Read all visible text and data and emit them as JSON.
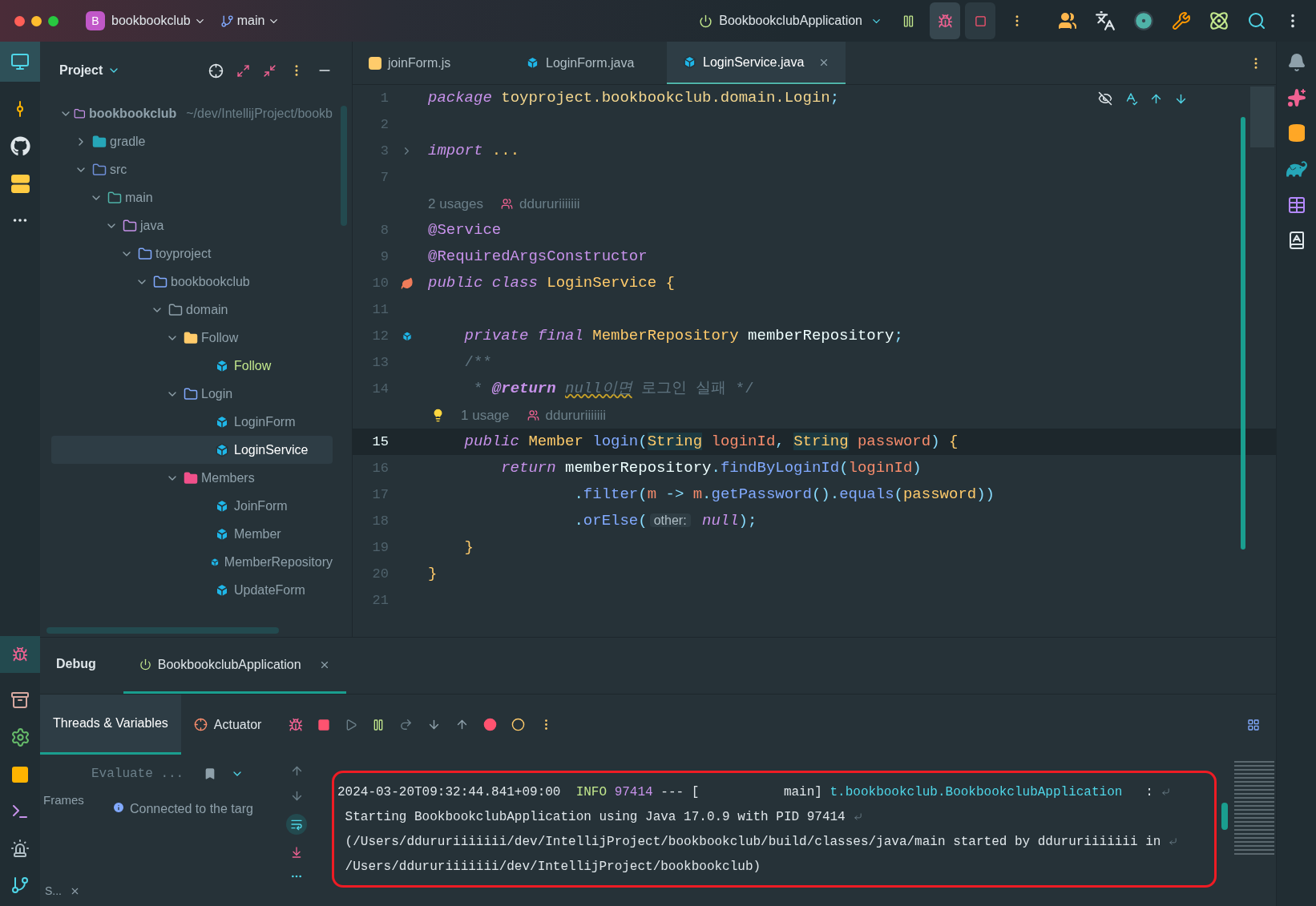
{
  "title_bar": {
    "project_badge": "B",
    "project": "bookbookclub",
    "branch": "main",
    "run_config": "BookbookclubApplication"
  },
  "project_panel": {
    "title": "Project",
    "tree": [
      {
        "label": "bookbookclub",
        "path": "~/dev/IntellijProject/bookb",
        "kind": "module",
        "expanded": true,
        "selected": false,
        "children": [
          {
            "label": "gradle",
            "kind": "gradle",
            "expanded": false,
            "selected": false
          },
          {
            "label": "src",
            "kind": "src",
            "expanded": true,
            "selected": false,
            "children": [
              {
                "label": "main",
                "kind": "main",
                "expanded": true,
                "selected": false,
                "children": [
                  {
                    "label": "java",
                    "kind": "java",
                    "expanded": true,
                    "selected": false,
                    "children": [
                      {
                        "label": "toyproject",
                        "kind": "folder",
                        "expanded": true,
                        "selected": false,
                        "children": [
                          {
                            "label": "bookbookclub",
                            "kind": "folder",
                            "expanded": true,
                            "selected": false,
                            "children": [
                              {
                                "label": "domain",
                                "kind": "domain",
                                "expanded": true,
                                "selected": false,
                                "children": [
                                  {
                                    "label": "Follow",
                                    "kind": "folder-yellow",
                                    "expanded": true,
                                    "selected": false,
                                    "children": [
                                      {
                                        "label": "Follow",
                                        "kind": "class",
                                        "added": true,
                                        "selected": false
                                      }
                                    ]
                                  },
                                  {
                                    "label": "Login",
                                    "kind": "folder",
                                    "expanded": true,
                                    "selected": false,
                                    "children": [
                                      {
                                        "label": "LoginForm",
                                        "kind": "class",
                                        "added": false,
                                        "selected": false
                                      },
                                      {
                                        "label": "LoginService",
                                        "kind": "class",
                                        "added": false,
                                        "selected": true
                                      }
                                    ]
                                  },
                                  {
                                    "label": "Members",
                                    "kind": "folder-red",
                                    "expanded": true,
                                    "selected": false,
                                    "children": [
                                      {
                                        "label": "JoinForm",
                                        "kind": "class",
                                        "added": false,
                                        "selected": false
                                      },
                                      {
                                        "label": "Member",
                                        "kind": "class",
                                        "added": false,
                                        "selected": false
                                      },
                                      {
                                        "label": "MemberRepository",
                                        "kind": "class",
                                        "added": false,
                                        "selected": false
                                      },
                                      {
                                        "label": "UpdateForm",
                                        "kind": "class",
                                        "added": false,
                                        "selected": false
                                      }
                                    ]
                                  }
                                ]
                              }
                            ]
                          }
                        ]
                      }
                    ]
                  }
                ]
              }
            ]
          }
        ]
      }
    ]
  },
  "editor": {
    "tabs": [
      {
        "label": "joinForm.js",
        "kind": "js",
        "selected": false
      },
      {
        "label": "LoginForm.java",
        "kind": "java",
        "selected": false
      },
      {
        "label": "LoginService.java",
        "kind": "java",
        "selected": true
      }
    ],
    "lines": [
      {
        "kind": "code",
        "number": "1",
        "current": false,
        "tokens": [
          {
            "text": "package",
            "kind": "kw"
          },
          {
            "text": " toyproject.bookbookclub.domain.Login",
            "kind": "pkg"
          },
          {
            "text": ";",
            "kind": "punct"
          }
        ]
      },
      {
        "kind": "code",
        "number": "2",
        "current": false
      },
      {
        "kind": "code",
        "number": "3",
        "current": false,
        "gutter": {
          "kind": "fold"
        },
        "tokens": [
          {
            "text": "import",
            "kind": "kw"
          },
          {
            "text": " ...",
            "kind": "fold"
          }
        ]
      },
      {
        "kind": "code",
        "number": "7",
        "current": false
      },
      {
        "kind": "hint",
        "usages": "2 usages",
        "author": "ddururiiiiiii",
        "bulb": false
      },
      {
        "kind": "code",
        "number": "8",
        "current": false,
        "tokens": [
          {
            "text": "@Service",
            "kind": "ann"
          }
        ]
      },
      {
        "kind": "code",
        "number": "9",
        "current": false,
        "tokens": [
          {
            "text": "@RequiredArgsConstructor",
            "kind": "ann"
          }
        ]
      },
      {
        "kind": "code",
        "number": "10",
        "current": false,
        "gutter": {
          "kind": "bean"
        },
        "tokens": [
          {
            "text": "public class",
            "kind": "kw"
          },
          {
            "text": " LoginService ",
            "kind": "type"
          },
          {
            "text": "{",
            "kind": "brace"
          }
        ]
      },
      {
        "kind": "code",
        "number": "11",
        "current": false
      },
      {
        "kind": "code",
        "number": "12",
        "current": false,
        "gutter": {
          "kind": "inject"
        },
        "tokens": [
          {
            "text": "    private final",
            "kind": "kw"
          },
          {
            "text": " MemberRepository",
            "kind": "type"
          },
          {
            "text": " memberRepository",
            "kind": "ident"
          },
          {
            "text": ";",
            "kind": "punct"
          }
        ]
      },
      {
        "kind": "code",
        "number": "13",
        "current": false,
        "tokens": [
          {
            "text": "    /**",
            "kind": "comment"
          }
        ]
      },
      {
        "kind": "code",
        "number": "14",
        "current": false,
        "tokens": [
          {
            "text": "     * ",
            "kind": "comment"
          },
          {
            "text": "@return ",
            "kind": "doctag"
          },
          {
            "text": "null이면",
            "kind": "typo"
          },
          {
            "text": " 로그인 실패 */",
            "kind": "comment"
          }
        ]
      },
      {
        "kind": "hint",
        "usages": "1 usage",
        "author": "ddururiiiiiii",
        "bulb": true
      },
      {
        "kind": "code",
        "number": "15",
        "current": true,
        "tokens": [
          {
            "text": "    public",
            "kind": "kw"
          },
          {
            "text": " Member ",
            "kind": "type"
          },
          {
            "text": "login",
            "kind": "fn"
          },
          {
            "text": "(",
            "kind": "punct"
          },
          {
            "text": "String",
            "kind": "type-hl"
          },
          {
            "text": " loginId",
            "kind": "param"
          },
          {
            "text": ", ",
            "kind": "punct"
          },
          {
            "text": "String",
            "kind": "type-hl"
          },
          {
            "text": " password",
            "kind": "param"
          },
          {
            "text": ") ",
            "kind": "punct"
          },
          {
            "text": "{",
            "kind": "brace"
          }
        ]
      },
      {
        "kind": "code",
        "number": "16",
        "current": false,
        "tokens": [
          {
            "text": "        return",
            "kind": "kw"
          },
          {
            "text": " memberRepository",
            "kind": "ident"
          },
          {
            "text": ".",
            "kind": "punct"
          },
          {
            "text": "findByLoginId",
            "kind": "fn"
          },
          {
            "text": "(",
            "kind": "punct"
          },
          {
            "text": "loginId",
            "kind": "param"
          },
          {
            "text": ")",
            "kind": "punct"
          }
        ]
      },
      {
        "kind": "code",
        "number": "17",
        "current": false,
        "tokens": [
          {
            "text": "                .",
            "kind": "punct"
          },
          {
            "text": "filter",
            "kind": "fn"
          },
          {
            "text": "(",
            "kind": "punct"
          },
          {
            "text": "m",
            "kind": "param"
          },
          {
            "text": " -> ",
            "kind": "punct"
          },
          {
            "text": "m",
            "kind": "param"
          },
          {
            "text": ".",
            "kind": "punct"
          },
          {
            "text": "getPassword",
            "kind": "fn"
          },
          {
            "text": "().",
            "kind": "punct"
          },
          {
            "text": "equals",
            "kind": "fn"
          },
          {
            "text": "(",
            "kind": "punct"
          },
          {
            "text": "password",
            "kind": "ident-y"
          },
          {
            "text": "))",
            "kind": "punct"
          }
        ]
      },
      {
        "kind": "code",
        "number": "18",
        "current": false,
        "tokens": [
          {
            "text": "                .",
            "kind": "punct"
          },
          {
            "text": "orElse",
            "kind": "fn"
          },
          {
            "text": "(",
            "kind": "punct"
          },
          {
            "text": "other:",
            "kind": "inlay"
          },
          {
            "text": " null",
            "kind": "kw"
          },
          {
            "text": ");",
            "kind": "punct"
          }
        ]
      },
      {
        "kind": "code",
        "number": "19",
        "current": false,
        "tokens": [
          {
            "text": "    }",
            "kind": "brace"
          }
        ]
      },
      {
        "kind": "code",
        "number": "20",
        "current": false,
        "tokens": [
          {
            "text": "}",
            "kind": "brace"
          }
        ]
      },
      {
        "kind": "code",
        "number": "21",
        "current": false
      }
    ]
  },
  "debug": {
    "title": "Debug",
    "tabs": [
      {
        "label": "BookbookclubApplication",
        "selected": true
      }
    ],
    "subtabs": [
      {
        "label": "Threads & Variables",
        "kind": "threads",
        "selected": true
      },
      {
        "label": "Actuator",
        "kind": "actuator",
        "selected": false
      }
    ],
    "evaluate": {
      "placeholder": "Evaluate ..."
    },
    "frames_label": "Frames",
    "status": "Connected to the targ",
    "session_tab": "S...",
    "console": [
      {
        "wrapped": true,
        "segments": [
          {
            "text": "2024-03-20T09:32:44.841+09:00  ",
            "kind": "plain"
          },
          {
            "text": "INFO",
            "kind": "info"
          },
          {
            "text": " 97414",
            "kind": "pid"
          },
          {
            "text": " --- [           main] ",
            "kind": "plain"
          },
          {
            "text": "t.bookbookclub.BookbookclubApplication",
            "kind": "logger"
          },
          {
            "text": "   :",
            "kind": "plain"
          }
        ]
      },
      {
        "wrapped": true,
        "segments": [
          {
            "text": " Starting BookbookclubApplication using Java 17.0.9 with PID 97414",
            "kind": "plain"
          }
        ]
      },
      {
        "wrapped": true,
        "segments": [
          {
            "text": " (/Users/ddururiiiiiii/dev/IntellijProject/bookbookclub/build/classes/java/main started by ddururiiiiiii in",
            "kind": "plain"
          }
        ]
      },
      {
        "wrapped": false,
        "segments": [
          {
            "text": " /Users/ddururiiiiiii/dev/IntellijProject/bookbookclub)",
            "kind": "plain"
          }
        ]
      }
    ]
  }
}
